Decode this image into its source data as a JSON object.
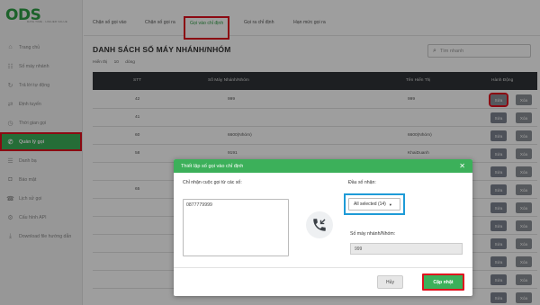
{
  "brand": {
    "logo": "ODS",
    "tagline": "DATA TIME · HIGHER VALUE"
  },
  "sidebar": {
    "items": [
      {
        "label": "Trang chủ",
        "icon": "home-icon"
      },
      {
        "label": "Số máy nhánh",
        "icon": "extension-icon"
      },
      {
        "label": "Trả lời tự động",
        "icon": "auto-reply-icon"
      },
      {
        "label": "Định tuyến",
        "icon": "route-icon"
      },
      {
        "label": "Thời gian gọi",
        "icon": "clock-icon"
      },
      {
        "label": "Quản lý gọi",
        "icon": "phone-icon",
        "active": true
      },
      {
        "label": "Danh bạ",
        "icon": "contacts-icon"
      },
      {
        "label": "Báo mật",
        "icon": "lock-icon"
      },
      {
        "label": "Lịch sử gọi",
        "icon": "history-icon"
      },
      {
        "label": "Cấu hình API",
        "icon": "api-icon"
      },
      {
        "label": "Download file hướng dẫn",
        "icon": "download-icon"
      }
    ]
  },
  "tabs": [
    {
      "label": "Chặn số gọi vào"
    },
    {
      "label": "Chặn số gọi ra"
    },
    {
      "label": "Gọi vào chỉ định",
      "active": true
    },
    {
      "label": "Gọi ra chỉ định"
    },
    {
      "label": "Hạn mức gọi ra"
    }
  ],
  "page": {
    "title": "DANH SÁCH SỐ MÁY NHÁNH/NHÓM",
    "show_label": "Hiển thị",
    "show_value": "10",
    "show_suffix": "dòng",
    "search_placeholder": "Tìm nhanh"
  },
  "table": {
    "headers": [
      "STT",
      "Số Máy Nhánh/Nhóm",
      "Tên Hiển Thị",
      "Hành Động"
    ],
    "rows": [
      {
        "stt": "42",
        "ext": "999",
        "name": "999"
      },
      {
        "stt": "41",
        "ext": "",
        "name": ""
      },
      {
        "stt": "60",
        "ext": "6600(Nhóm)",
        "name": "6600(Nhóm)"
      },
      {
        "stt": "58",
        "ext": "9191",
        "name": "KhaiDuanh"
      },
      {
        "stt": "",
        "ext": "",
        "name": ""
      },
      {
        "stt": "65",
        "ext": "",
        "name": ""
      },
      {
        "stt": "",
        "ext": "",
        "name": ""
      },
      {
        "stt": "",
        "ext": "",
        "name": ""
      },
      {
        "stt": "",
        "ext": "",
        "name": ""
      },
      {
        "stt": "",
        "ext": "",
        "name": ""
      },
      {
        "stt": "",
        "ext": "",
        "name": ""
      },
      {
        "stt": "",
        "ext": "",
        "name": ""
      }
    ],
    "edit_label": "Sửa",
    "delete_label": "Xóa"
  },
  "modal": {
    "title": "Thiết lập số gọi vào chỉ định",
    "left_label": "Chỉ nhận cuộc gọi từ các số:",
    "numbers_value": "0877779999",
    "prefix_label": "Đầu số nhận:",
    "prefix_value": "All selected (14)",
    "ext_label": "Số máy nhánh/Nhóm:",
    "ext_value": "999",
    "cancel_label": "Hủy",
    "update_label": "Cập nhật"
  },
  "colors": {
    "accent": "#3cb05a",
    "highlight_red": "#e0101e",
    "highlight_blue": "#1e9bd7",
    "table_head": "#2f3337"
  }
}
